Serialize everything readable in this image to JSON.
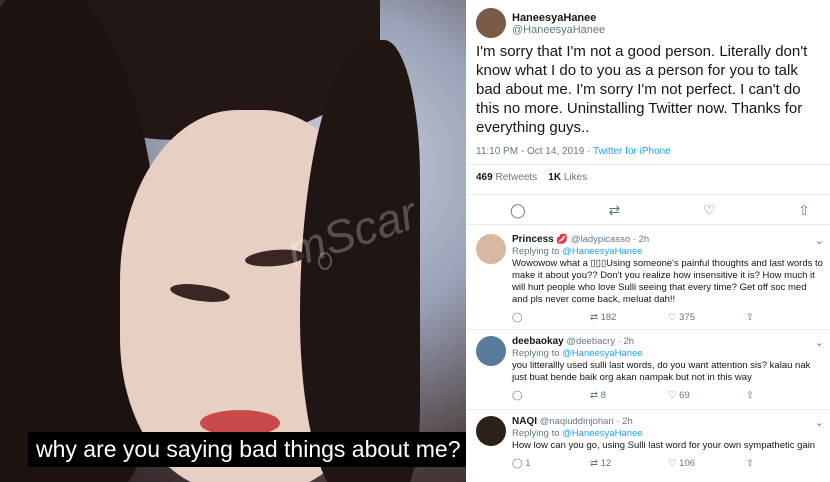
{
  "video": {
    "subtitle": "why are you saying bad things about me?",
    "watermark": "mScar"
  },
  "tweet": {
    "name": "HaneesyaHanee",
    "handle": "@HaneesyaHanee",
    "text": "I'm sorry that I'm not a good person. Literally don't know what I do to you as a person for you to talk bad about me. I'm sorry I'm not perfect. I can't do this no more. Uninstalling Twitter now. Thanks for everything guys..",
    "time": "11:10 PM - Oct 14, 2019",
    "sep": " · ",
    "source": "Twitter for iPhone",
    "retweets_count": "469",
    "retweets_label": "Retweets",
    "likes_count": "1K",
    "likes_label": "Likes",
    "icons": {
      "reply": "◯",
      "retweet": "⇄",
      "like": "♡",
      "share": "⇧"
    }
  },
  "replies": [
    {
      "name": "Princess",
      "emoji": "💋",
      "handle": "@ladypicasso",
      "age": "· 2h",
      "replying_label": "Replying to",
      "replying_to": "@HaneesyaHanee",
      "text": "Wowowow what a ▯▯▯Using someone's painful thoughts and last words to make it about you?? Don't you realize how insensitive it is? How much it will hurt people who love Sulli seeing that every time? Get off soc med and pls never come back, meluat dah!!",
      "retweets": "182",
      "likes": "375",
      "replies_count": ""
    },
    {
      "name": "deebaokay",
      "emoji": "",
      "handle": "@deebacry",
      "age": "· 2h",
      "replying_label": "Replying to",
      "replying_to": "@HaneesyaHanee",
      "text": "you litterallly used sulli last words, do you want attention sis? kalau nak just buat bende baik org akan nampak but not in this way",
      "retweets": "8",
      "likes": "69",
      "replies_count": ""
    },
    {
      "name": "NAQI",
      "emoji": "",
      "handle": "@naqiuddinjohari",
      "age": "· 2h",
      "replying_label": "Replying to",
      "replying_to": "@HaneesyaHanee",
      "text": "How low can you go, using Sulli last word for your own sympathetic gain",
      "retweets": "12",
      "likes": "106",
      "replies_count": "1"
    }
  ],
  "chevron": "⌄"
}
